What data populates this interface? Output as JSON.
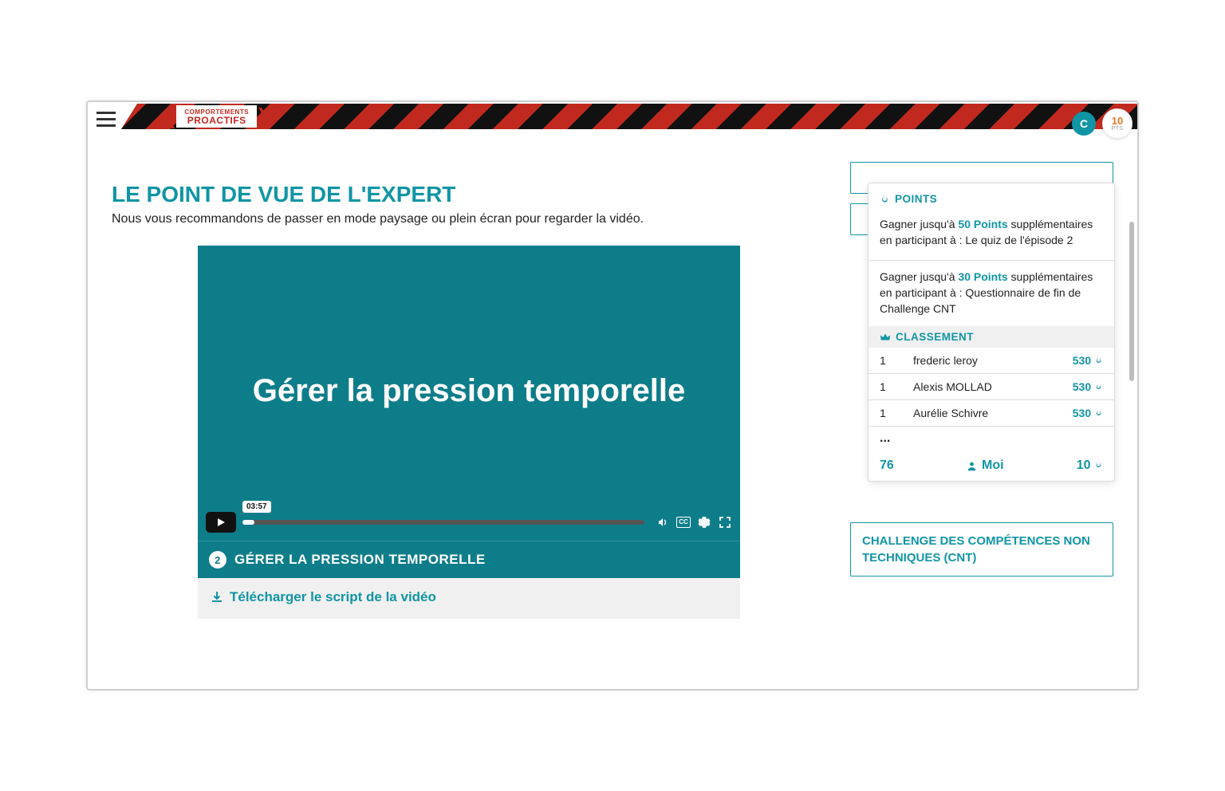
{
  "branding": {
    "line1": "COMPORTEMENTS",
    "line2": "PROACTIFS"
  },
  "user": {
    "initial": "C",
    "points": "10",
    "points_unit": "PTS"
  },
  "page": {
    "title": "LE POINT DE VUE DE L'EXPERT",
    "subtitle": "Nous vous recommandons de passer en mode paysage ou plein écran pour regarder la vidéo."
  },
  "video": {
    "headline": "Gérer la pression temporelle",
    "time_tooltip": "03:57",
    "cc_label": "CC",
    "caption_number": "2",
    "caption_text": "GÉRER LA PRESSION TEMPORELLE",
    "download_label": "Télécharger le script de la vidéo"
  },
  "points_panel": {
    "heading": "POINTS",
    "items": [
      {
        "prefix": "Gagner jusqu'à ",
        "points": "50 Points",
        "suffix": " supplémentaires en participant à : Le quiz de l'épisode 2"
      },
      {
        "prefix": "Gagner jusqu'à ",
        "points": "30 Points",
        "suffix": " supplémentaires en participant à : Questionnaire de fin de Challenge CNT"
      }
    ]
  },
  "leaderboard": {
    "heading": "CLASSEMENT",
    "rows": [
      {
        "rank": "1",
        "name": "frederic leroy",
        "score": "530"
      },
      {
        "rank": "1",
        "name": "Alexis MOLLAD",
        "score": "530"
      },
      {
        "rank": "1",
        "name": "Aurélie Schivre",
        "score": "530"
      }
    ],
    "ellipsis": "...",
    "me": {
      "rank": "76",
      "label": "Moi",
      "score": "10"
    }
  },
  "bottom_box": {
    "text": "CHALLENGE DES COMPÉTENCES NON TECHNIQUES (CNT)"
  }
}
